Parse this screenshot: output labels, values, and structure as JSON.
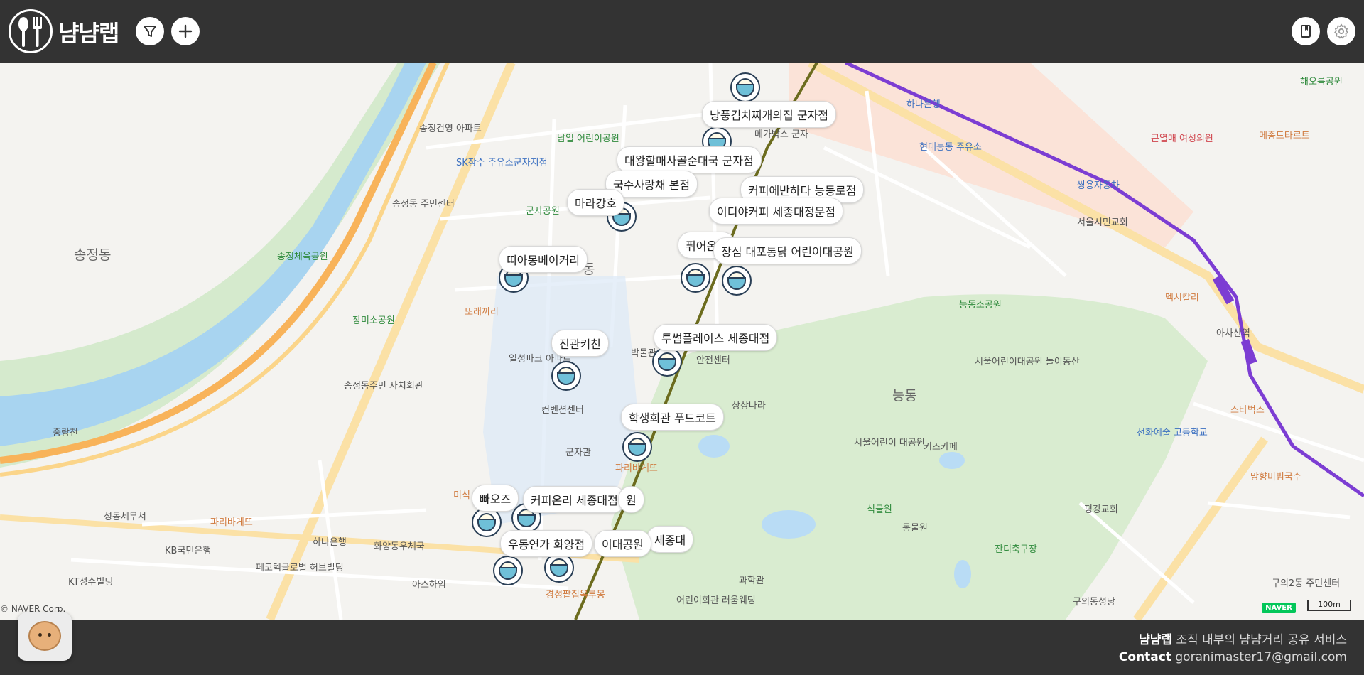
{
  "header": {
    "app_title": "냠냠랩",
    "icons": {
      "logo": "spoon-fork-icon",
      "filter": "filter-funnel-icon",
      "add": "plus-icon",
      "bookmark": "bookmark-icon",
      "settings": "gear-icon"
    }
  },
  "map": {
    "area_labels": [
      "송정동",
      "능동",
      "동"
    ],
    "pois": [
      "송정건영 아파트",
      "남일 어린이공원",
      "SK장수 주유소군자지점",
      "송정동 주민센터",
      "군자공원",
      "송정체육공원",
      "장미소공원",
      "또래끼리",
      "일성파크 아파트",
      "송정동주민 자치회관",
      "중랑천",
      "컨벤션센터",
      "군자관",
      "파리바게뜨",
      "미식",
      "성동세무서",
      "파리바게뜨",
      "KB국민은행",
      "하나은행",
      "화양동우체국",
      "페코텍글로벌 허브빌딩",
      "KT성수빌딩",
      "아스하임",
      "경성팥집옥루몽",
      "과학관",
      "어린이회관 러움웨딩",
      "동물원",
      "식물원",
      "잔디축구장",
      "서울어린이 대공원",
      "키즈카페",
      "서울어린이대공원 놀이동산",
      "능동소공원",
      "서울시민교회",
      "쌍용자동차",
      "현대능동 주유소",
      "하나은행",
      "큰열매 여성의원",
      "메종드타르트",
      "해오름공원",
      "멕시칼리",
      "아차산역",
      "스타벅스",
      "선화예술 고등학교",
      "망향비빔국수",
      "평강교회",
      "구의2동 주민센터",
      "구의동성당",
      "메가박스 군자",
      "상상나라",
      "박물관",
      "안전센터"
    ],
    "places": [
      "낭풍김치찌개의집 군자점",
      "대왕할매사골순대국 군자점",
      "국수사랑채 본점",
      "커피에반하다 능동로점",
      "이디야커피 세종대정문점",
      "마라강호",
      "퓌어온스",
      "장심 대포통닭 어린이대공원",
      "띠아몽베이커리",
      "투썸플레이스 세종대점",
      "진관키친",
      "학생회관 푸드코트",
      "빠오즈",
      "커피온리 세종대점",
      "원",
      "세종대",
      "우동연가 화양점",
      "이대공원"
    ],
    "copyright": "© NAVER Corp.",
    "naver_badge": "NAVER",
    "scale_label": "100m",
    "colors": {
      "river": "#a8d4f0",
      "park": "#d7ebce",
      "major_road": "#fbd58a",
      "subway_line7": "#7c3dd3",
      "subway_line2": "#6c6c1e"
    }
  },
  "footer": {
    "line1_brand": "냠냠랩",
    "line1_text": " 조직 내부의 냠냠거리 공유 서비스",
    "line2_label": "Contact",
    "line2_text": " goranimaster17@gmail.com",
    "chat_icon": "chat-character-icon"
  }
}
